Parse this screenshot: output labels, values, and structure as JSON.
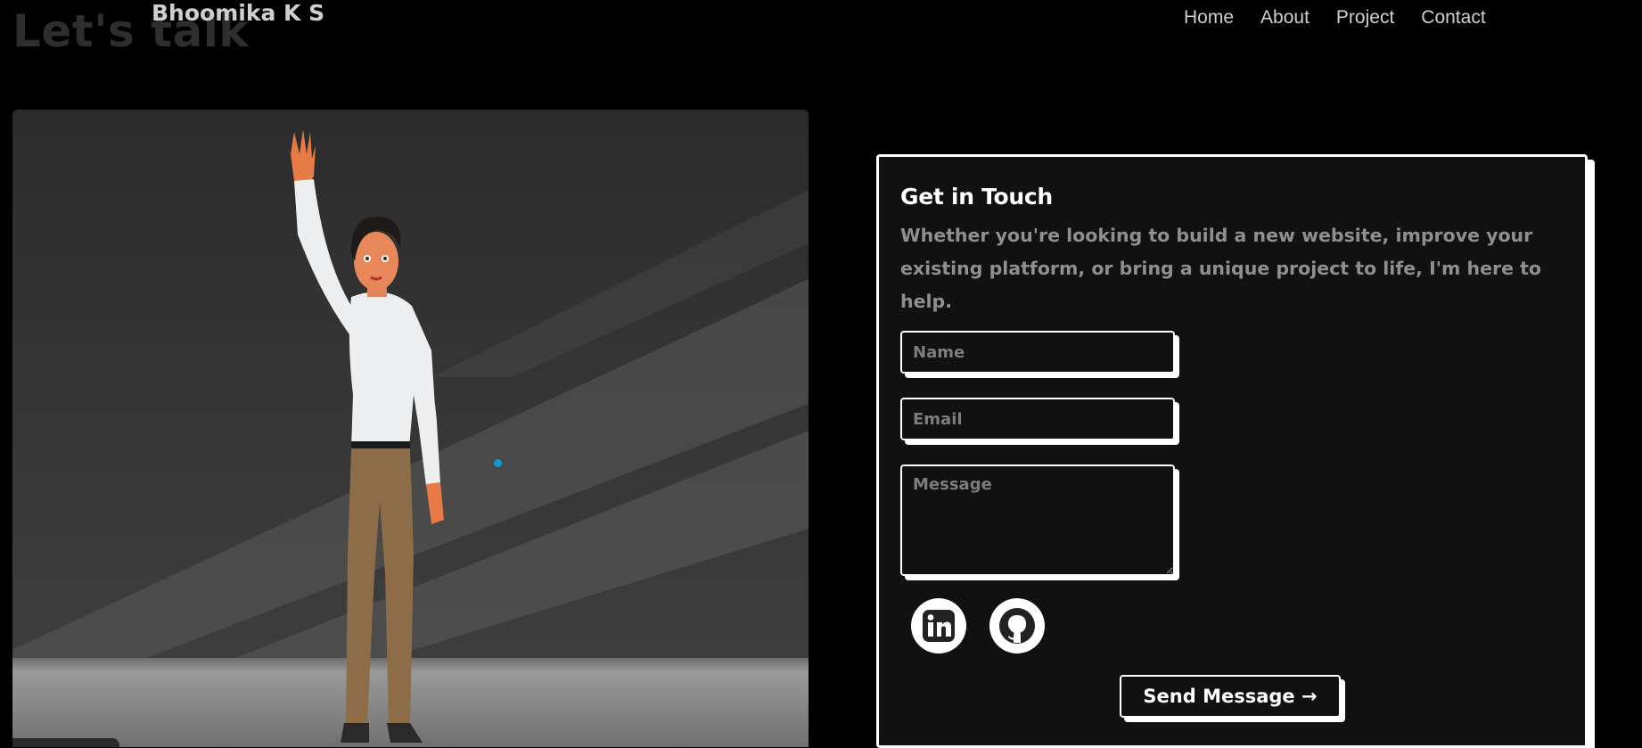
{
  "background_heading": "Let's talk",
  "brand": "Bhoomika K S",
  "nav": {
    "home": "Home",
    "about": "About",
    "project": "Project",
    "contact": "Contact"
  },
  "contact_card": {
    "title": "Get in Touch",
    "description": "Whether you're looking to build a new website, improve your existing platform, or bring a unique project to life, I'm here to help.",
    "name_placeholder": "Name",
    "email_placeholder": "Email",
    "message_placeholder": "Message",
    "send_label": "Send Message →"
  },
  "social_icons": [
    "linkedin-icon",
    "github-icon"
  ],
  "colors": {
    "background": "#000000",
    "card": "#111111",
    "accent_dot": "#0a9bd6"
  }
}
